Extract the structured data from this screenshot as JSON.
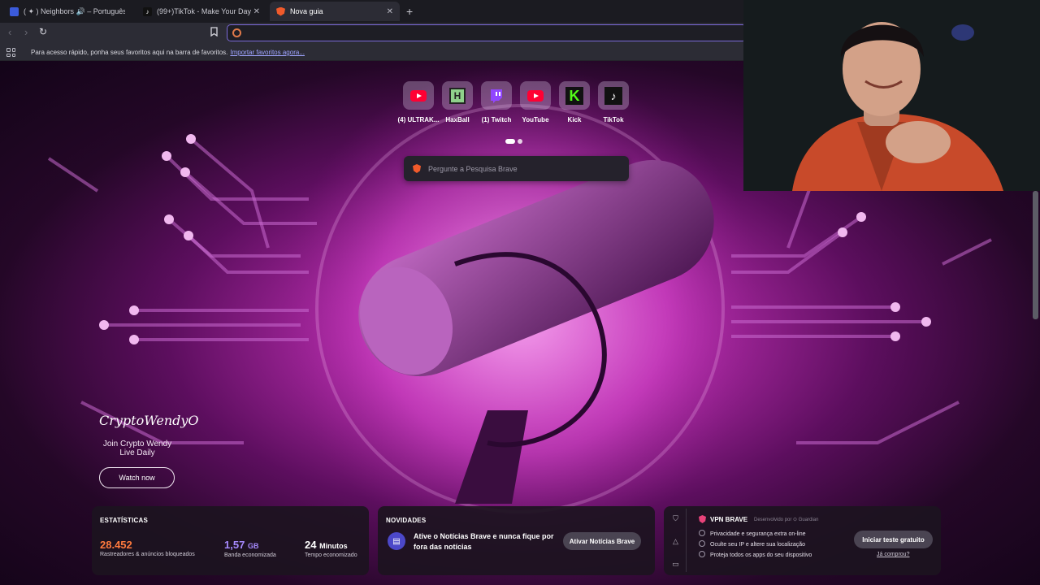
{
  "tabs": [
    {
      "title": "( ✦ ) Neighbors 🔊 – Português | Site",
      "favicon_color": "#3b5bdb"
    },
    {
      "title": "(99+)TikTok - Make Your Day",
      "favicon_color": "#111111"
    },
    {
      "title": "Nova guia",
      "favicon_color": "#f15a2b",
      "active": true
    }
  ],
  "toolbar": {
    "back_icon": "chevron-left",
    "forward_icon": "chevron-right",
    "reload_icon": "reload",
    "bookmark_icon": "bookmark"
  },
  "bookmarks_bar": {
    "text": "Para acesso rápido, ponha seus favoritos aqui na barra de favoritos.",
    "link": "Importar favoritos agora..."
  },
  "shortcuts": [
    {
      "label": "(4) ULTRAK...",
      "icon": "youtube-icon",
      "color": "#ff0033"
    },
    {
      "label": "HaxBall",
      "icon": "haxball-icon",
      "color": "#8fd18b"
    },
    {
      "label": "(1) Twitch",
      "icon": "twitch-icon",
      "color": "#9146ff"
    },
    {
      "label": "YouTube",
      "icon": "youtube-icon",
      "color": "#ff0033"
    },
    {
      "label": "Kick",
      "icon": "kick-icon",
      "color": "#53fc18"
    },
    {
      "label": "TikTok",
      "icon": "tiktok-icon",
      "color": "#111111"
    }
  ],
  "search": {
    "placeholder": "Pergunte a Pesquisa Brave"
  },
  "sponsor": {
    "brand": "CryptoWendyO",
    "tagline": "Join Crypto Wendy Live Daily",
    "button": "Watch now"
  },
  "stats": {
    "title": "ESTATÍSTICAS",
    "blocked_value": "28.452",
    "blocked_label": "Rastreadores & anúncios bloqueados",
    "bandwidth_value": "1,57",
    "bandwidth_unit": "GB",
    "bandwidth_label": "Banda economizada",
    "time_value": "24",
    "time_unit": "Minutos",
    "time_label": "Tempo economizado",
    "colors": {
      "blocked": "#ff7a3d",
      "bandwidth": "#a78bff",
      "time": "#ffffff"
    }
  },
  "news": {
    "title": "NOVIDADES",
    "text": "Ative o Notícias Brave e nunca fique por fora das notícias",
    "button": "Ativar Notícias Brave"
  },
  "vpn": {
    "title": "VPN BRAVE",
    "by": "Desenvolvido por",
    "by_brand": "Guardian",
    "features": [
      "Privacidade e segurança extra on-line",
      "Oculte seu IP e altere sua localização",
      "Proteja todos os apps do seu dispositivo"
    ],
    "button": "Iniciar teste gratuito",
    "link": "Já comprou?"
  }
}
